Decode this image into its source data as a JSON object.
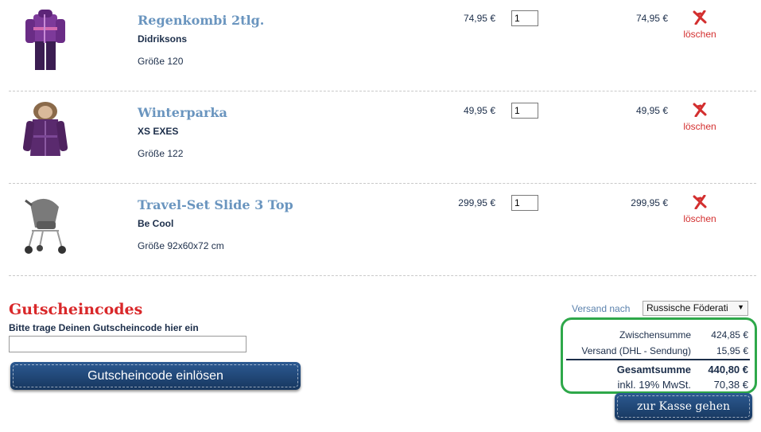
{
  "cart": {
    "items": [
      {
        "name": "Regenkombi 2tlg.",
        "brand": "Didriksons",
        "size": "Größe 120",
        "price": "74,95 €",
        "qty": "1",
        "total": "74,95 €",
        "delete_label": "löschen",
        "image": "purple-rain-suit"
      },
      {
        "name": "Winterparka",
        "brand": "XS EXES",
        "size": "Größe 122",
        "price": "49,95 €",
        "qty": "1",
        "total": "49,95 €",
        "delete_label": "löschen",
        "image": "purple-parka"
      },
      {
        "name": "Travel-Set Slide 3 Top",
        "brand": "Be Cool",
        "size": "Größe 92x60x72 cm",
        "price": "299,95 €",
        "qty": "1",
        "total": "299,95 €",
        "delete_label": "löschen",
        "image": "grey-stroller"
      }
    ]
  },
  "coupon": {
    "title": "Gutscheincodes",
    "hint": "Bitte trage Deinen Gutscheincode hier ein",
    "value": "",
    "button_label": "Gutscheincode einlösen"
  },
  "shipping": {
    "label": "Versand nach",
    "selected": "Russische Föderati"
  },
  "summary": {
    "subtotal_label": "Zwischensumme",
    "subtotal": "424,85 €",
    "shipping_label": "Versand (DHL - Sendung)",
    "shipping": "15,95 €",
    "grand_label": "Gesamtsumme",
    "grand": "440,80 €",
    "vat_label": "inkl. 19% MwSt.",
    "vat": "70,38 €"
  },
  "checkout_label": "zur Kasse gehen",
  "colors": {
    "accent_red": "#d9282a",
    "link_blue": "#6a95bf",
    "button_blue": "#17375f",
    "highlight_green": "#2ea84a"
  }
}
